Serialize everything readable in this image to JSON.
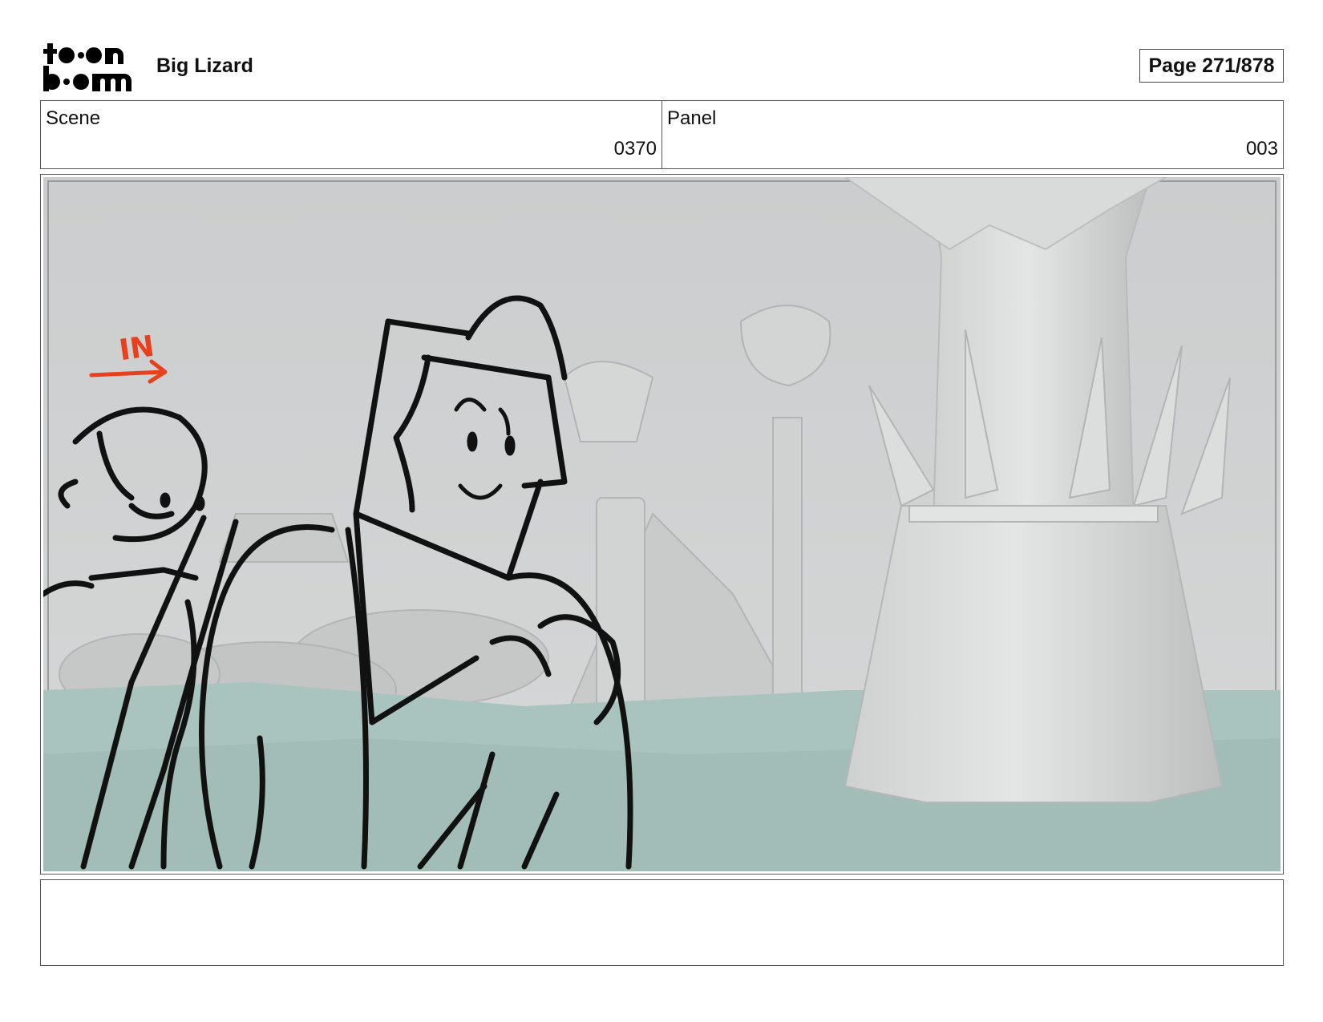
{
  "header": {
    "logo_text": "toonboom",
    "project_title": "Big Lizard",
    "page_label": "Page 271/878"
  },
  "info": {
    "scene_label": "Scene",
    "scene_value": "0370",
    "panel_label": "Panel",
    "panel_value": "003"
  },
  "panel_image": {
    "annotation": "IN",
    "annotation_color": "#e8401c",
    "sky_color": "#cdcfd0",
    "ground_color": "#a9c4be",
    "line_color": "#111111"
  },
  "notes": {
    "text": ""
  }
}
